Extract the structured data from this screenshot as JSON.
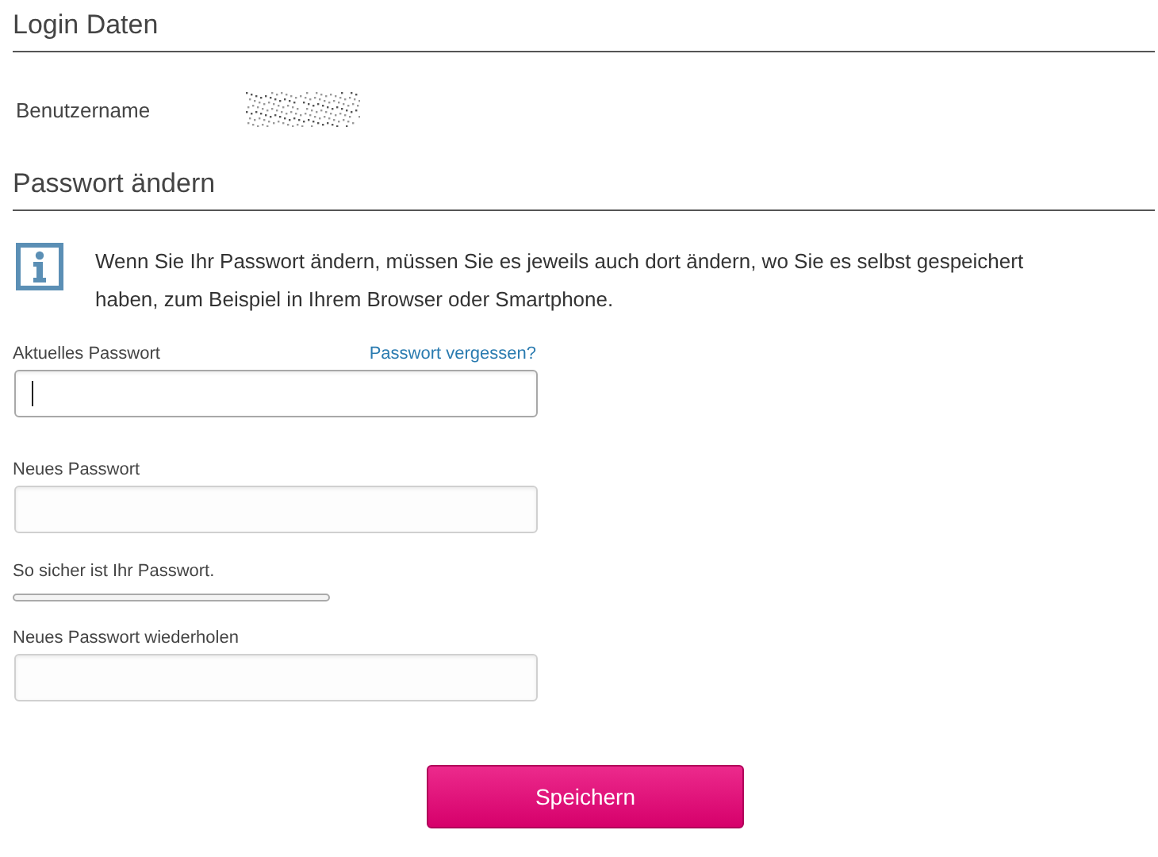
{
  "login_section": {
    "heading": "Login Daten",
    "username_label": "Benutzername"
  },
  "password_section": {
    "heading": "Passwort ändern",
    "info_text": "Wenn Sie Ihr Passwort ändern, müssen Sie es jeweils auch dort ändern, wo Sie es selbst gespeichert haben, zum Beispiel in Ihrem Browser oder Smartphone.",
    "fields": [
      {
        "kind": "field",
        "label": "Aktuelles Passwort",
        "link": "Passwort vergessen?",
        "focused": true
      },
      {
        "kind": "field",
        "label": "Neues Passwort",
        "focused": false
      },
      {
        "kind": "meter",
        "label": "So sicher ist Ihr Passwort.",
        "level": 0
      },
      {
        "kind": "field",
        "label": "Neues Passwort wiederholen",
        "focused": false
      }
    ],
    "save_button": "Speichern"
  }
}
